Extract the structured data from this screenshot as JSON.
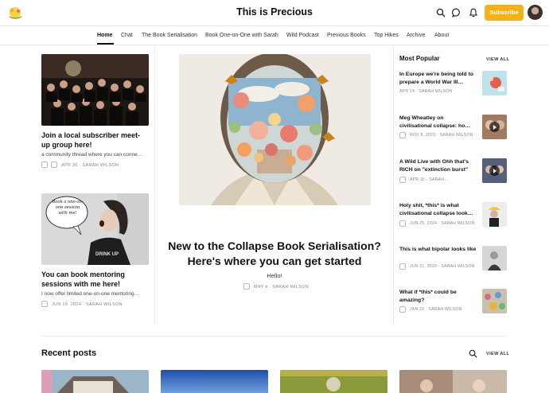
{
  "header": {
    "title": "This is Precious",
    "subscribe_label": "Subscribe",
    "icons": [
      "search-icon",
      "chat-icon",
      "bell-icon"
    ]
  },
  "nav": {
    "items": [
      "Home",
      "Chat",
      "The Book Serialisation",
      "Book One-on-One with Sarah",
      "Wild Podcast",
      "Previous Books",
      "Top Hikes",
      "Archive",
      "About"
    ],
    "active": "Home"
  },
  "left_posts": [
    {
      "title": "Join a local subscriber meet-up group here!",
      "subtitle": "a community thread where you can conne…",
      "meta": "APR 30 · SARAH WILSON"
    },
    {
      "title": "You can book mentoring sessions with me here!",
      "subtitle": "I now offer limited one-on-one mentoring…",
      "meta": "JUN 19, 2024 · SARAH WILSON",
      "image_text": "Book a one-on-one session with me!"
    }
  ],
  "hero": {
    "title": "New to the Collapse Book Serialisation? Here's where you can get started",
    "subtitle": "Hello!",
    "meta": "MAY 4 · SARAH WILSON"
  },
  "most_popular": {
    "heading": "Most Popular",
    "view_all": "VIEW ALL",
    "items": [
      {
        "title": "In Europe we're being told to prepare a World War III…",
        "meta": "APR 14 · SARAH WILSON"
      },
      {
        "title": "Meg Wheatley on civilisational collapse: ho…",
        "meta": "NOV 8, 2023 · SARAH WILSON"
      },
      {
        "title": "A Wild Live with Ohh that's RICH on \"extinction burst\"",
        "meta": "APR 16 · SARAH…"
      },
      {
        "title": "Holy shit, *this* is what civilisational collapse look…",
        "meta": "JUN 25, 2024 · SARAH WILSON"
      },
      {
        "title": "This is what bipolar looks like",
        "meta": "JUN 21, 2023 · SARAH WILSON"
      },
      {
        "title": "What if *this* could be amazing?",
        "meta": "JAN 22 · SARAH WILSON"
      }
    ]
  },
  "recent": {
    "heading": "Recent posts",
    "view_all": "VIEW ALL"
  },
  "colors": {
    "accent": "#f3b21c",
    "text": "#111111",
    "muted": "#888888",
    "divider": "#ececec"
  }
}
